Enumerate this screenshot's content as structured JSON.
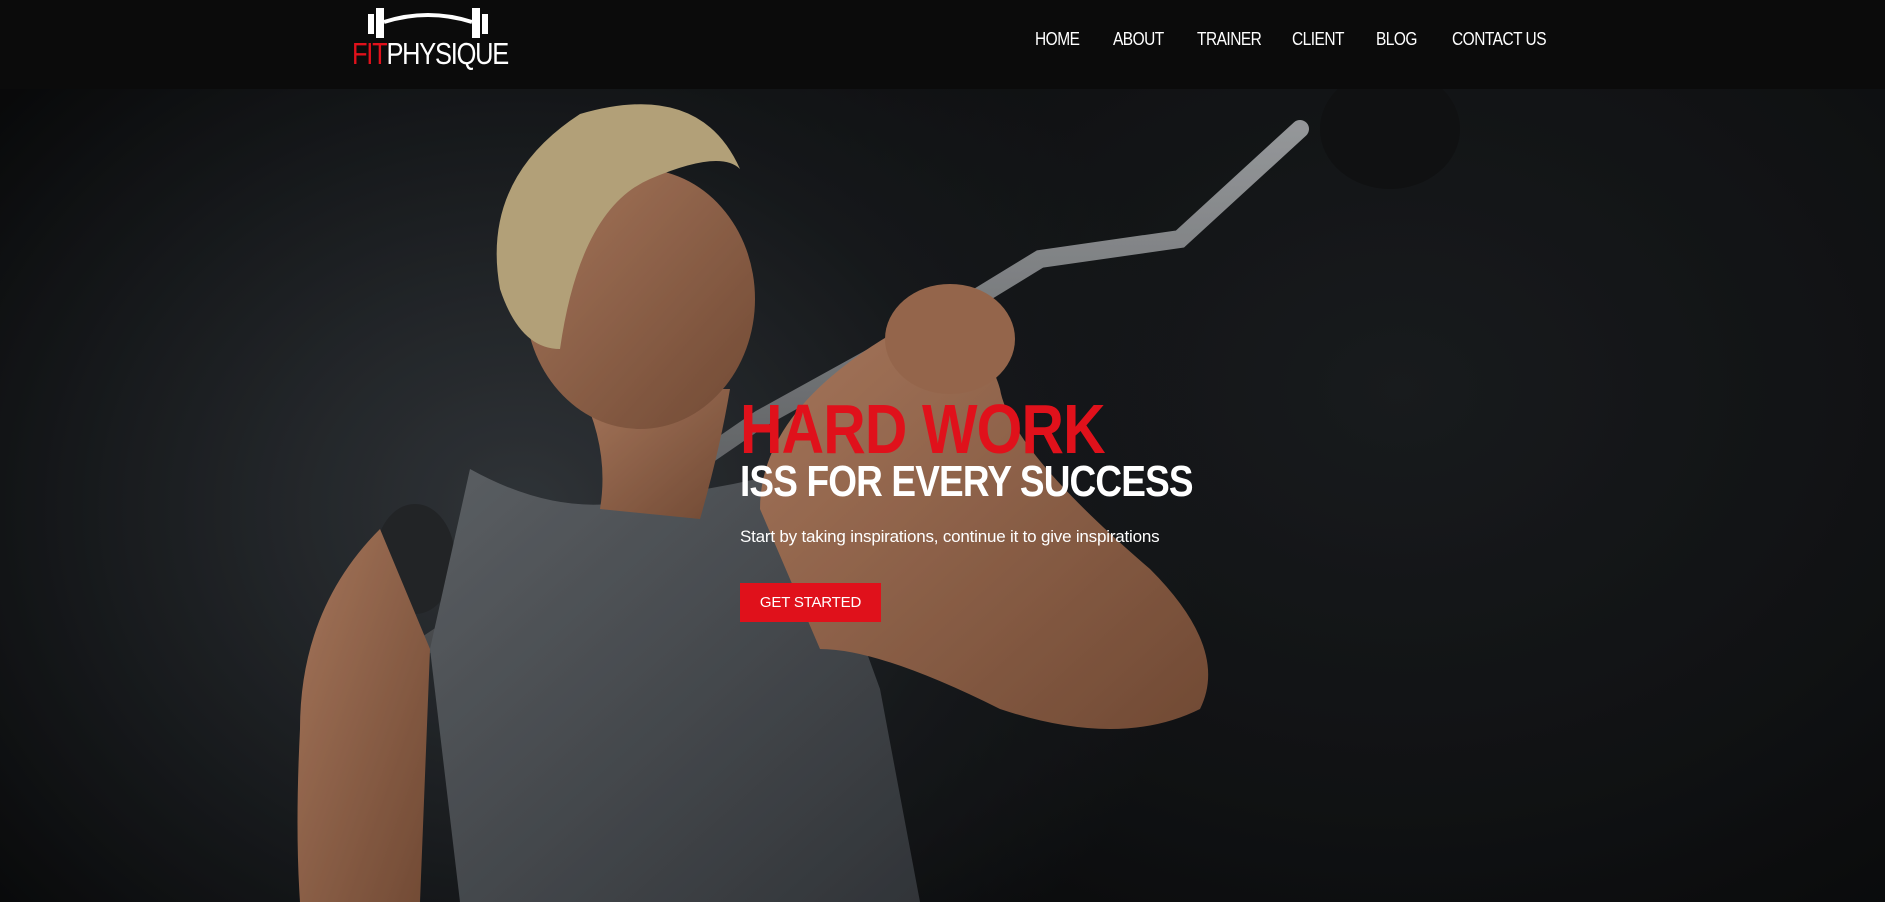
{
  "brand": {
    "name_part1": "FIT",
    "name_part2": "PHYSIQUE",
    "accent_color": "#e0111b",
    "logo_icon": "barbell-icon"
  },
  "nav": {
    "items": [
      {
        "label": "HOME"
      },
      {
        "label": "ABOUT"
      },
      {
        "label": "TRAINER"
      },
      {
        "label": "CLIENT"
      },
      {
        "label": "BLOG"
      },
      {
        "label": "CONTACT US"
      }
    ]
  },
  "hero": {
    "title": "HARD WORK",
    "subtitle": "ISS FOR EVERY SUCCESS",
    "tagline": "Start by taking inspirations, continue it to give inspirations",
    "cta_label": "GET STARTED",
    "background_image": "athlete-with-barbell-photo"
  }
}
